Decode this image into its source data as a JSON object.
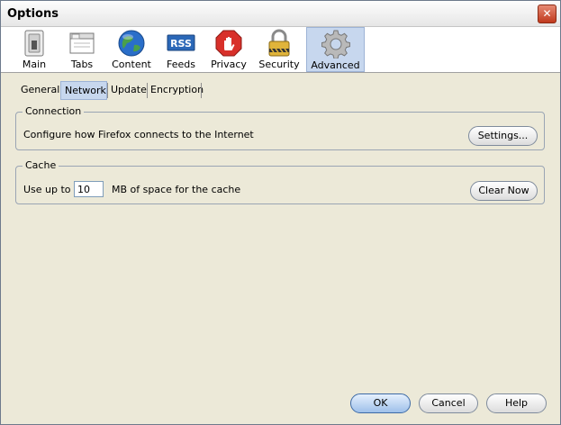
{
  "window": {
    "title": "Options"
  },
  "panes": [
    {
      "label": "Main",
      "icon": "switch-icon"
    },
    {
      "label": "Tabs",
      "icon": "tabs-icon"
    },
    {
      "label": "Content",
      "icon": "globe-icon"
    },
    {
      "label": "Feeds",
      "icon": "rss-icon",
      "badge": "RSS"
    },
    {
      "label": "Privacy",
      "icon": "stop-hand-icon"
    },
    {
      "label": "Security",
      "icon": "lock-icon"
    },
    {
      "label": "Advanced",
      "icon": "gear-icon"
    }
  ],
  "subtabs": [
    {
      "label": "General"
    },
    {
      "label": "Network"
    },
    {
      "label": "Update"
    },
    {
      "label": "Encryption"
    }
  ],
  "connection": {
    "title": "Connection",
    "description": "Configure how Firefox connects to the Internet",
    "settings_label": "Settings..."
  },
  "cache": {
    "title": "Cache",
    "use_up_to_label": "Use up to",
    "size_value": "10",
    "size_suffix": "MB of space for the cache",
    "clear_label": "Clear Now"
  },
  "footer": {
    "ok_label": "OK",
    "cancel_label": "Cancel",
    "help_label": "Help"
  },
  "colors": {
    "accent": "#c7d7ee",
    "close_red": "#c0391d"
  }
}
